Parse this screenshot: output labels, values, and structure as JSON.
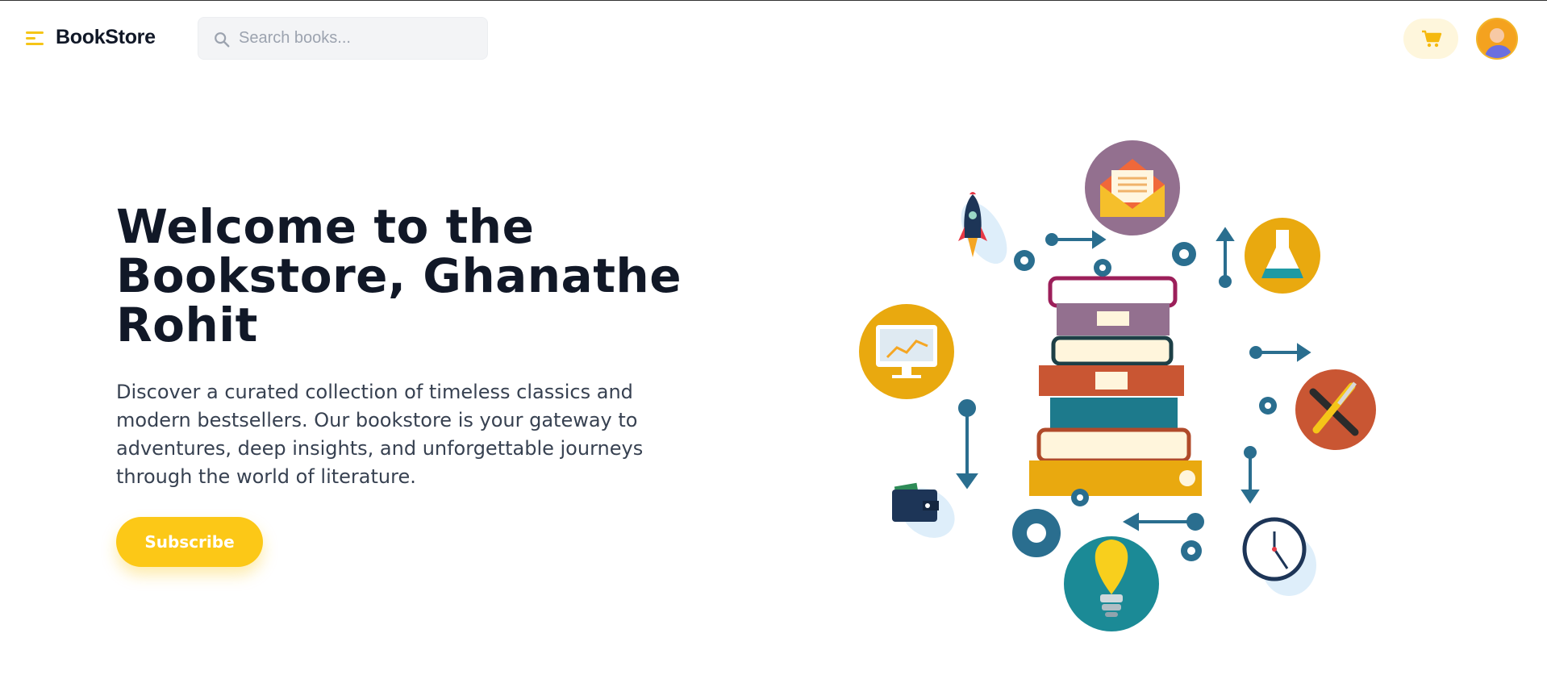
{
  "header": {
    "brand": "BookStore",
    "search_placeholder": "Search books...",
    "menu_icon": "hamburger-menu-icon",
    "cart_icon": "shopping-cart-icon",
    "avatar_icon": "user-avatar"
  },
  "hero": {
    "title": "Welcome to the Bookstore, Ghanathe Rohit",
    "description": "Discover a curated collection of timeless classics and modern bestsellers. Our bookstore is your gateway to adventures, deep insights, and unforgettable journeys through the world of literature.",
    "subscribe_label": "Subscribe"
  },
  "colors": {
    "accent": "#fcc817",
    "text": "#111827",
    "muted": "#374151",
    "search_bg": "#f3f4f6"
  }
}
